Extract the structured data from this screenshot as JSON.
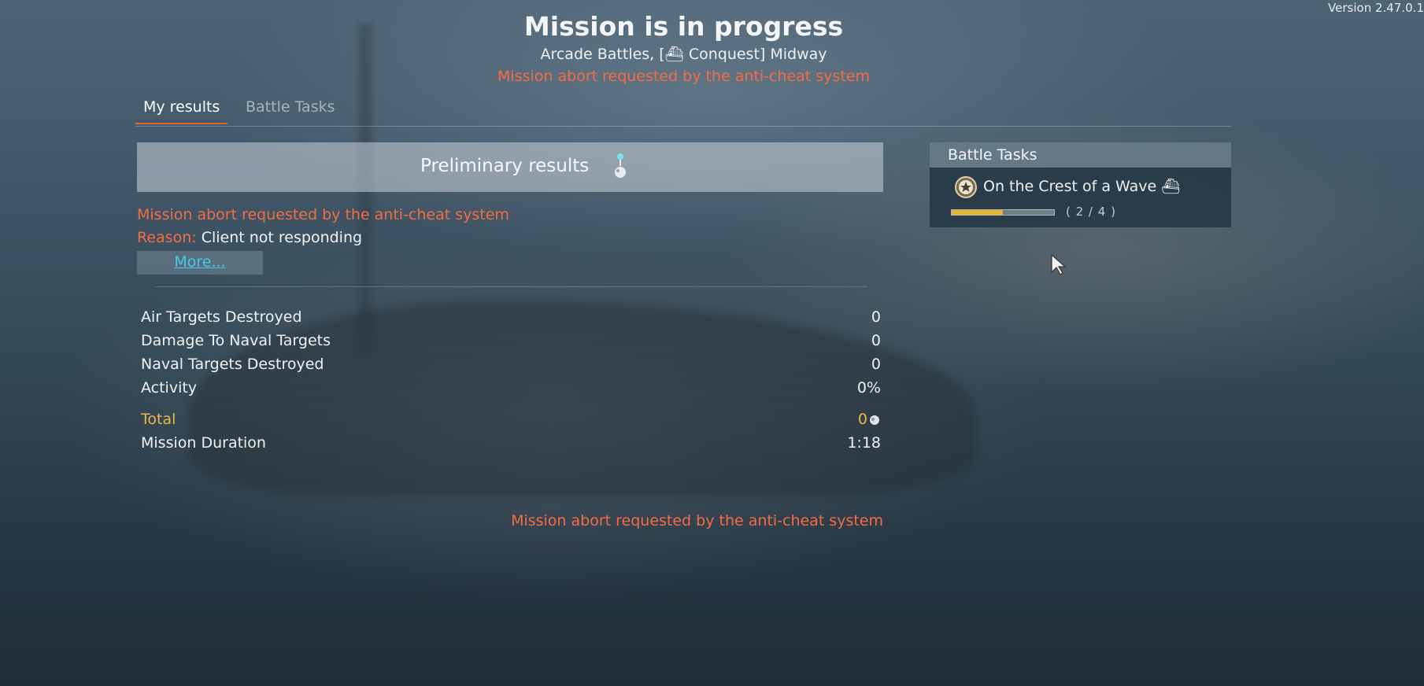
{
  "version": "Version 2.47.0.1",
  "header": {
    "title": "Mission is in progress",
    "subtitle": "Arcade Battles, [⛴ Conquest] Midway",
    "abort_notice": "Mission abort requested by the anti-cheat system"
  },
  "tabs": [
    {
      "label": "My results",
      "active": true
    },
    {
      "label": "Battle Tasks",
      "active": false
    }
  ],
  "results": {
    "banner": "Preliminary results",
    "abort_message": "Mission abort requested by the anti-cheat system",
    "reason_label": "Reason:",
    "reason_value": "Client not responding",
    "more_label": "More...",
    "stats": [
      {
        "label": "Air Targets Destroyed",
        "value": "0"
      },
      {
        "label": "Damage To Naval Targets",
        "value": "0"
      },
      {
        "label": "Naval Targets Destroyed",
        "value": "0"
      },
      {
        "label": "Activity",
        "value": "0%"
      }
    ],
    "total": {
      "label": "Total",
      "value": "0"
    },
    "duration": {
      "label": "Mission Duration",
      "value": "1:18"
    },
    "bottom_abort": "Mission abort requested by the anti-cheat system"
  },
  "battle_tasks_panel": {
    "header": "Battle Tasks",
    "task": {
      "name": "On the Crest of a Wave ⛴",
      "progress_text": "( 2 / 4 )",
      "progress_fraction": 0.5
    }
  },
  "colors": {
    "abort_red": "#f46b44",
    "total_gold": "#e8b84c",
    "tab_accent": "#e1672e",
    "link_blue": "#47c7ee",
    "progress_gold": "#e6b62d"
  }
}
